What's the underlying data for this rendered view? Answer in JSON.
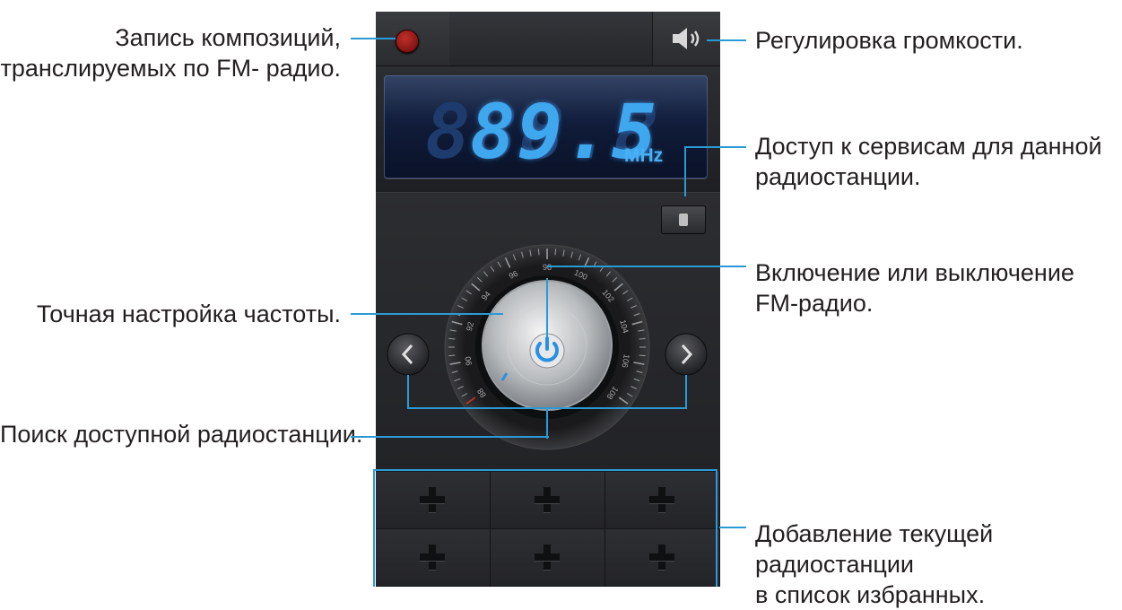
{
  "callouts": {
    "record": "Запись композиций,\nтранслируемых по FM- радио.",
    "volume": "Регулировка громкости.",
    "station_services": "Доступ к сервисам для данной\nрадиостанции.",
    "power": "Включение или выключение\nFM-радио.",
    "fine_tune": "Точная настройка частоты.",
    "search": "Поиск доступной радиостанции.",
    "favorites": "Добавление текущей радиостанции\nв список избранных."
  },
  "display": {
    "frequency": "89.5",
    "ghost_digits": "888.8",
    "unit": "MHz"
  },
  "dial": {
    "scale_labels": [
      "88",
      "90",
      "92",
      "94",
      "96",
      "98",
      "100",
      "102",
      "104",
      "106",
      "108"
    ],
    "bottom_labels": [
      "88",
      "108"
    ]
  },
  "presets": {
    "count": 6,
    "icon": "plus-icon"
  },
  "colors": {
    "accent": "#2a9ad6",
    "lcd_digits": "#3fa7ee",
    "record": "#c0302a",
    "power_icon": "#2a8fe0"
  }
}
